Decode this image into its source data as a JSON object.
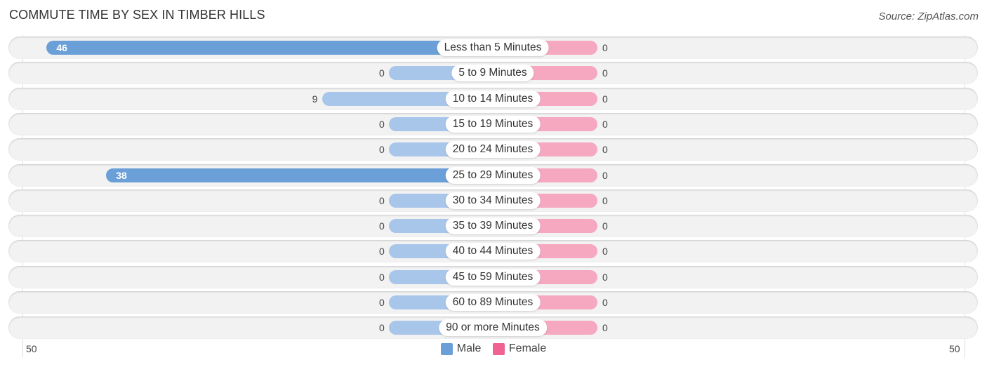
{
  "title": "COMMUTE TIME BY SEX IN TIMBER HILLS",
  "source": "Source: ZipAtlas.com",
  "colors": {
    "male": "#6a9fd8",
    "male_light": "#a8c6ea",
    "female": "#f5a8c0",
    "female_legend": "#f06292"
  },
  "chart_data": {
    "type": "bar",
    "orientation": "horizontal-diverging",
    "title": "COMMUTE TIME BY SEX IN TIMBER HILLS",
    "categories": [
      "Less than 5 Minutes",
      "5 to 9 Minutes",
      "10 to 14 Minutes",
      "15 to 19 Minutes",
      "20 to 24 Minutes",
      "25 to 29 Minutes",
      "30 to 34 Minutes",
      "35 to 39 Minutes",
      "40 to 44 Minutes",
      "45 to 59 Minutes",
      "60 to 89 Minutes",
      "90 or more Minutes"
    ],
    "series": [
      {
        "name": "Male",
        "values": [
          46,
          0,
          9,
          0,
          0,
          38,
          0,
          0,
          0,
          0,
          0,
          0
        ]
      },
      {
        "name": "Female",
        "values": [
          0,
          0,
          0,
          0,
          0,
          0,
          0,
          0,
          0,
          0,
          0,
          0
        ]
      }
    ],
    "axis": {
      "left_tick": "50",
      "right_tick": "50",
      "range": [
        0,
        50
      ]
    },
    "legend": [
      "Male",
      "Female"
    ],
    "legend_position": "bottom-center"
  }
}
